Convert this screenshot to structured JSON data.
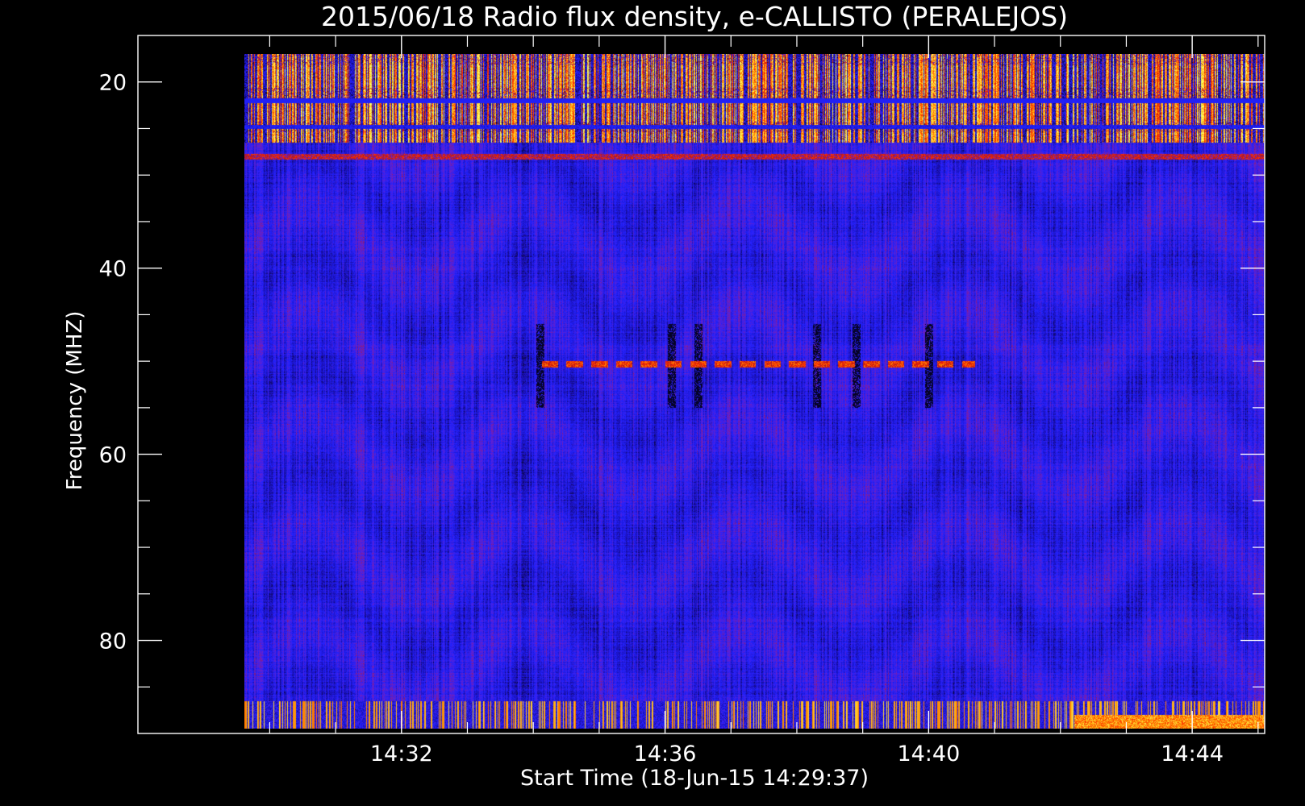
{
  "chart_data": {
    "type": "heatmap",
    "title": "2015/06/18  Radio flux density, e-CALLISTO (PERALEJOS)",
    "xlabel": "Start Time (18-Jun-15 14:29:37)",
    "ylabel": "Frequency (MHZ)",
    "x_axis": {
      "start": "14:29:37",
      "end": "14:44:41",
      "range_min": [
        28.0,
        45.1
      ],
      "major_ticks": [
        "14:32",
        "14:36",
        "14:40",
        "14:44"
      ],
      "major_tick_min": [
        32,
        36,
        40,
        44
      ],
      "minor_tick_min": [
        30,
        31,
        33,
        34,
        35,
        37,
        38,
        39,
        41,
        42,
        43,
        45
      ]
    },
    "y_axis": {
      "range": [
        15,
        90
      ],
      "inverted": true,
      "major_ticks": [
        20,
        40,
        60,
        80
      ],
      "minor_ticks": [
        25,
        30,
        35,
        45,
        50,
        55,
        65,
        70,
        75,
        85
      ],
      "data_range": [
        17.0,
        89.5
      ]
    },
    "colormap": [
      "#000000",
      "#1a0fb0",
      "#2222ff",
      "#6a20c8",
      "#b01818",
      "#ff2a00",
      "#ff9a00",
      "#ffff60"
    ],
    "background_level": 0.28,
    "features": [
      {
        "name": "interference band",
        "f_range": [
          17.0,
          26.5
        ],
        "intensity": 0.8
      },
      {
        "name": "interference band",
        "f_range": [
          86.0,
          89.5
        ],
        "intensity": 0.68
      },
      {
        "name": "narrowband line",
        "freq": 28.0,
        "intensity": 0.6
      },
      {
        "name": "narrowband line",
        "freq": 50.3,
        "t_range": [
          34.1,
          40.7
        ],
        "intensity": 0.62,
        "dashed": true
      },
      {
        "name": "absorption lines",
        "t_min": [
          34.1,
          36.1,
          36.5,
          38.3,
          38.9,
          40.0
        ],
        "f_range": [
          46.0,
          55.0
        ]
      },
      {
        "name": "enhancement",
        "t_range": [
          42.2,
          45.1
        ],
        "f_range": [
          88.0,
          89.5
        ],
        "intensity": 0.85
      }
    ]
  }
}
